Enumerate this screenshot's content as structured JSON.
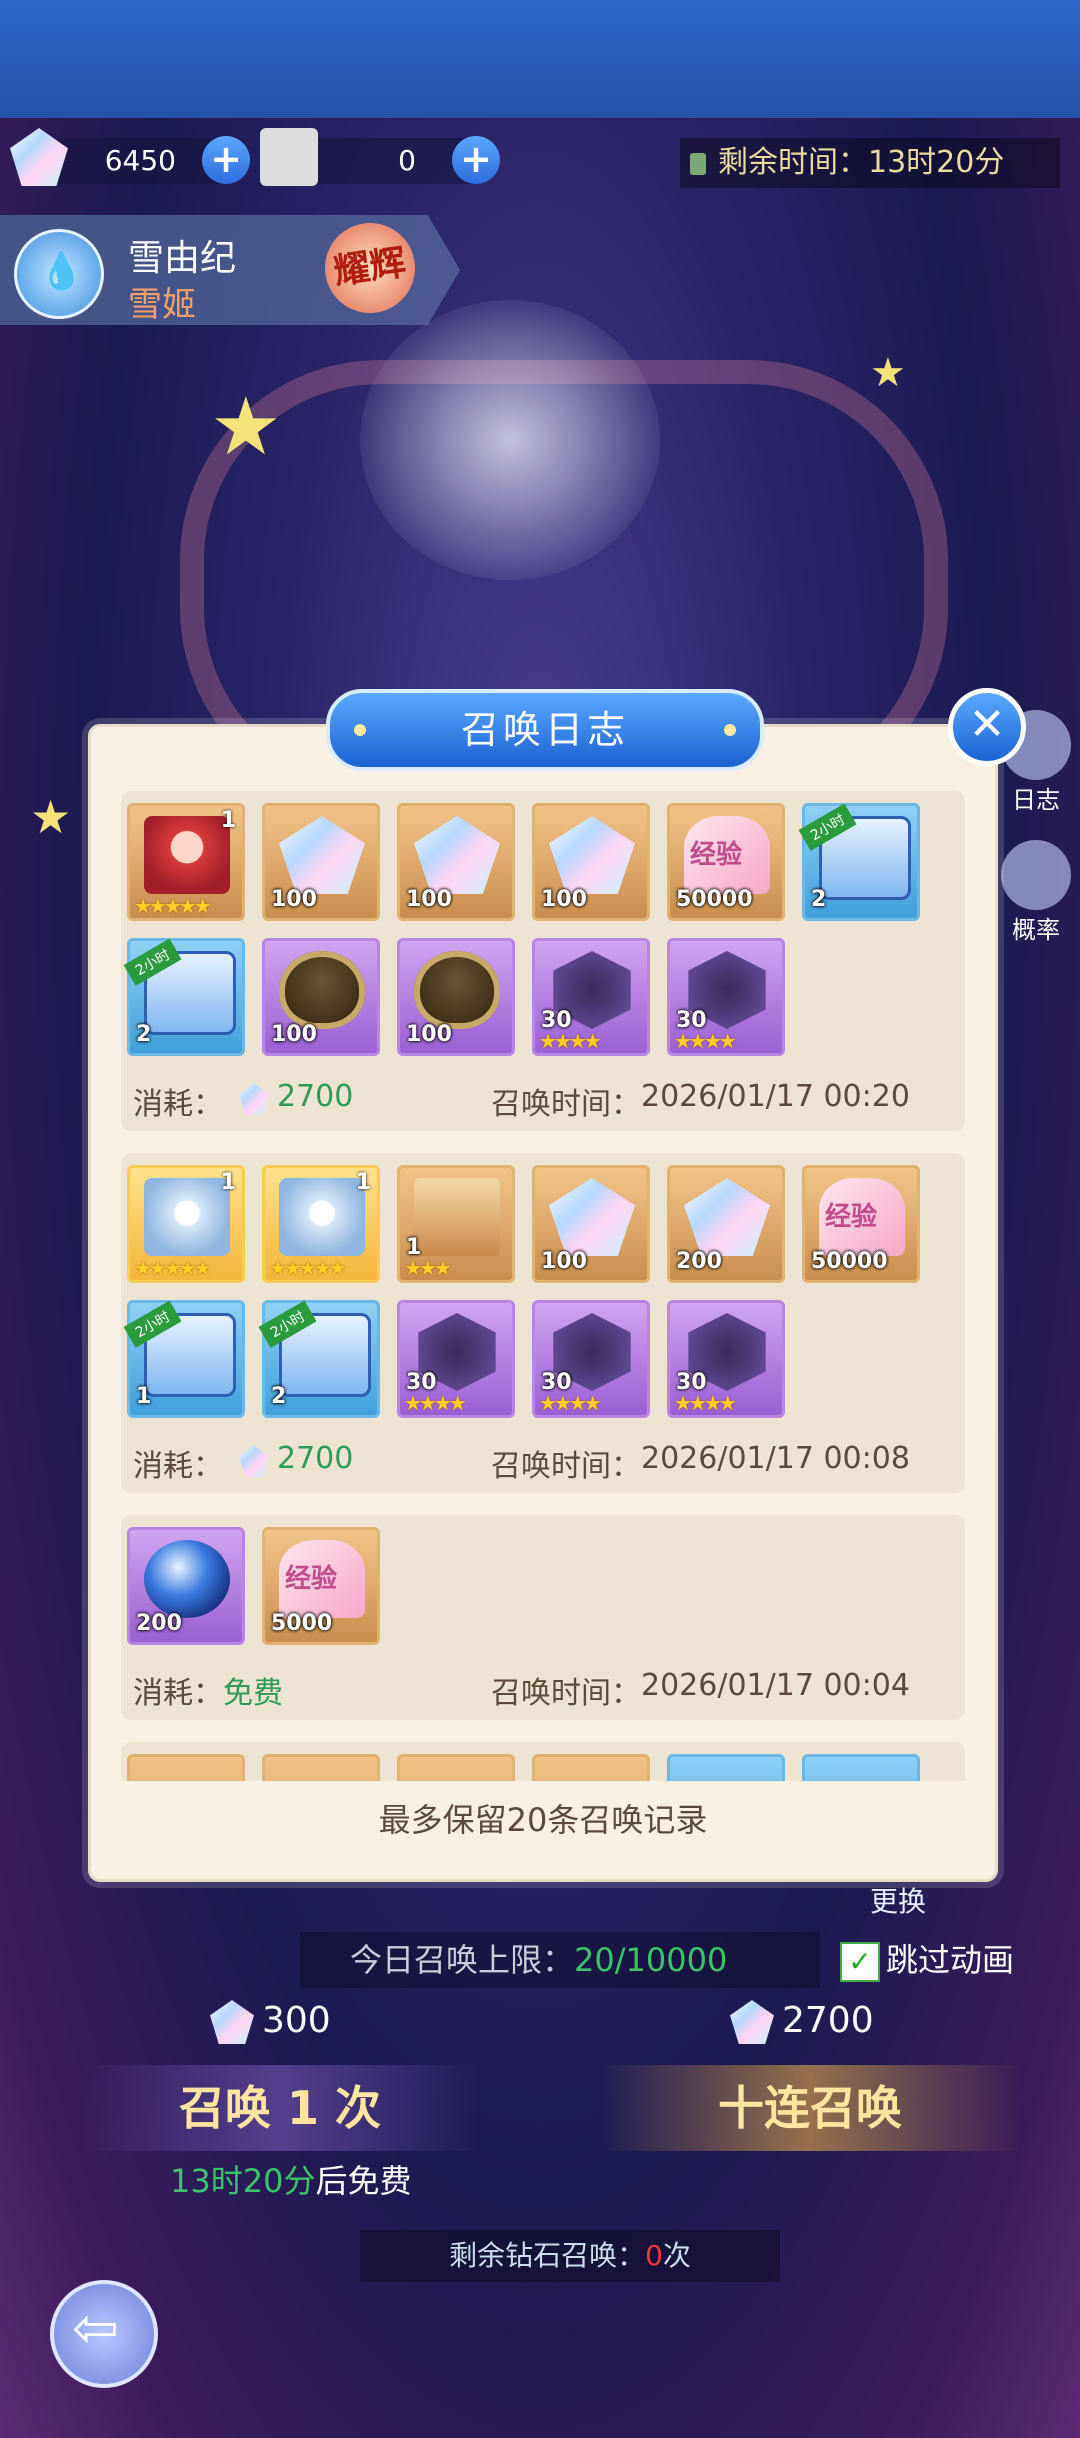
{
  "resources": {
    "gems": "6450",
    "tickets": "0",
    "plus": "+"
  },
  "time_remaining": "剩余时间：13时20分",
  "hero": {
    "name": "雪由纪",
    "title": "雪姬",
    "badge": "耀辉"
  },
  "side_buttons": {
    "log": "日志",
    "rate": "概率"
  },
  "dialog": {
    "title": "召唤日志",
    "close": "✕",
    "footer_note": "最多保留20条召唤记录",
    "cost_label": "消耗：",
    "time_label": "召唤时间："
  },
  "records": [
    {
      "cost": "2700",
      "time": "2026/01/17 00:20",
      "row1": [
        {
          "type": "hero-red",
          "level": "1",
          "stars": "★★★★★"
        },
        {
          "type": "gem",
          "count": "100"
        },
        {
          "type": "gem",
          "count": "100"
        },
        {
          "type": "gem",
          "count": "100"
        },
        {
          "type": "heart",
          "count": "50000",
          "label": "经验"
        },
        {
          "type": "chest",
          "count": "2",
          "ribbon": "2小时"
        }
      ],
      "row2": [
        {
          "type": "chest",
          "count": "2",
          "ribbon": "2小时"
        },
        {
          "type": "egg",
          "count": "100"
        },
        {
          "type": "egg",
          "count": "100"
        },
        {
          "type": "shard",
          "count": "30",
          "stars": "★★★★"
        },
        {
          "type": "shard",
          "count": "30",
          "stars": "★★★★"
        }
      ]
    },
    {
      "cost": "2700",
      "time": "2026/01/17 00:08",
      "row1": [
        {
          "type": "hero-white",
          "level": "1",
          "stars": "★★★★★"
        },
        {
          "type": "hero-white",
          "level": "1",
          "stars": "★★★★★"
        },
        {
          "type": "box",
          "count": "1",
          "stars": "★★★"
        },
        {
          "type": "gem",
          "count": "100"
        },
        {
          "type": "gem",
          "count": "200"
        },
        {
          "type": "heart",
          "count": "50000",
          "label": "经验"
        }
      ],
      "row2": [
        {
          "type": "chest",
          "count": "1",
          "ribbon": "2小时"
        },
        {
          "type": "chest",
          "count": "2",
          "ribbon": "2小时"
        },
        {
          "type": "shard",
          "count": "30",
          "stars": "★★★★"
        },
        {
          "type": "shard",
          "count": "30",
          "stars": "★★★★"
        },
        {
          "type": "shard",
          "count": "30",
          "stars": "★★★★"
        }
      ]
    },
    {
      "cost": "免费",
      "time": "2026/01/17 00:04",
      "row1": [
        {
          "type": "orb",
          "count": "200"
        },
        {
          "type": "heart",
          "count": "5000",
          "label": "经验"
        }
      ]
    }
  ],
  "bottom": {
    "swap": "更换",
    "limit_label": "今日召唤上限：",
    "limit_value": "20/10000",
    "skip": "跳过动画",
    "single_cost": "300",
    "ten_cost": "2700",
    "single_summon": "召唤 1 次",
    "ten_summon": "十连召唤",
    "free_time": "13时20分",
    "free_suffix": "后免费",
    "diamond_left_prefix": "剩余钻石召唤：",
    "diamond_left_value": "0",
    "diamond_left_suffix": "次"
  }
}
